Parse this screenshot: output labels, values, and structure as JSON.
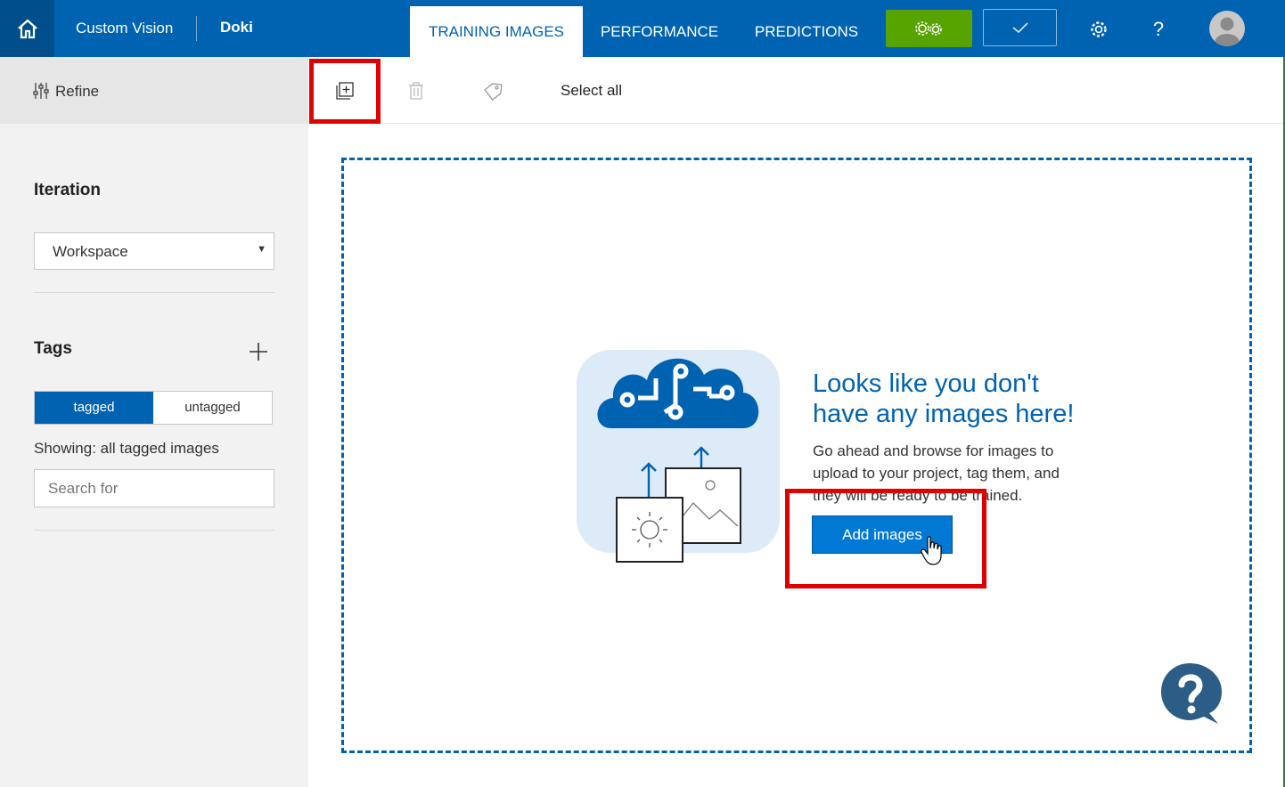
{
  "header": {
    "brand": "Custom Vision",
    "project": "Doki",
    "tabs": [
      {
        "label": "TRAINING IMAGES",
        "active": true
      },
      {
        "label": "PERFORMANCE",
        "active": false
      },
      {
        "label": "PREDICTIONS",
        "active": false
      }
    ],
    "help_label": "?",
    "icons": [
      "home-icon",
      "train-gears-icon",
      "quick-test-check-icon",
      "settings-gear-icon",
      "help-icon",
      "avatar"
    ],
    "accent_color": "#0063b1",
    "train_color": "#57a300"
  },
  "sidebar": {
    "refine_label": "Refine",
    "iteration_title": "Iteration",
    "iteration_value": "Workspace",
    "tags_title": "Tags",
    "filter_options": [
      "tagged",
      "untagged"
    ],
    "filter_selected": "tagged",
    "showing_text": "Showing: all tagged images",
    "search_placeholder": "Search for"
  },
  "toolbar": {
    "select_all_label": "Select all",
    "icons": [
      "add-images-icon",
      "delete-icon",
      "tag-icon"
    ]
  },
  "empty_state": {
    "title_line1": "Looks like you don't",
    "title_line2": "have any images here!",
    "description": "Go ahead and browse for images to upload to your project, tag them, and they will be ready to be trained.",
    "button_label": "Add images"
  },
  "highlight_color": "#e00000"
}
